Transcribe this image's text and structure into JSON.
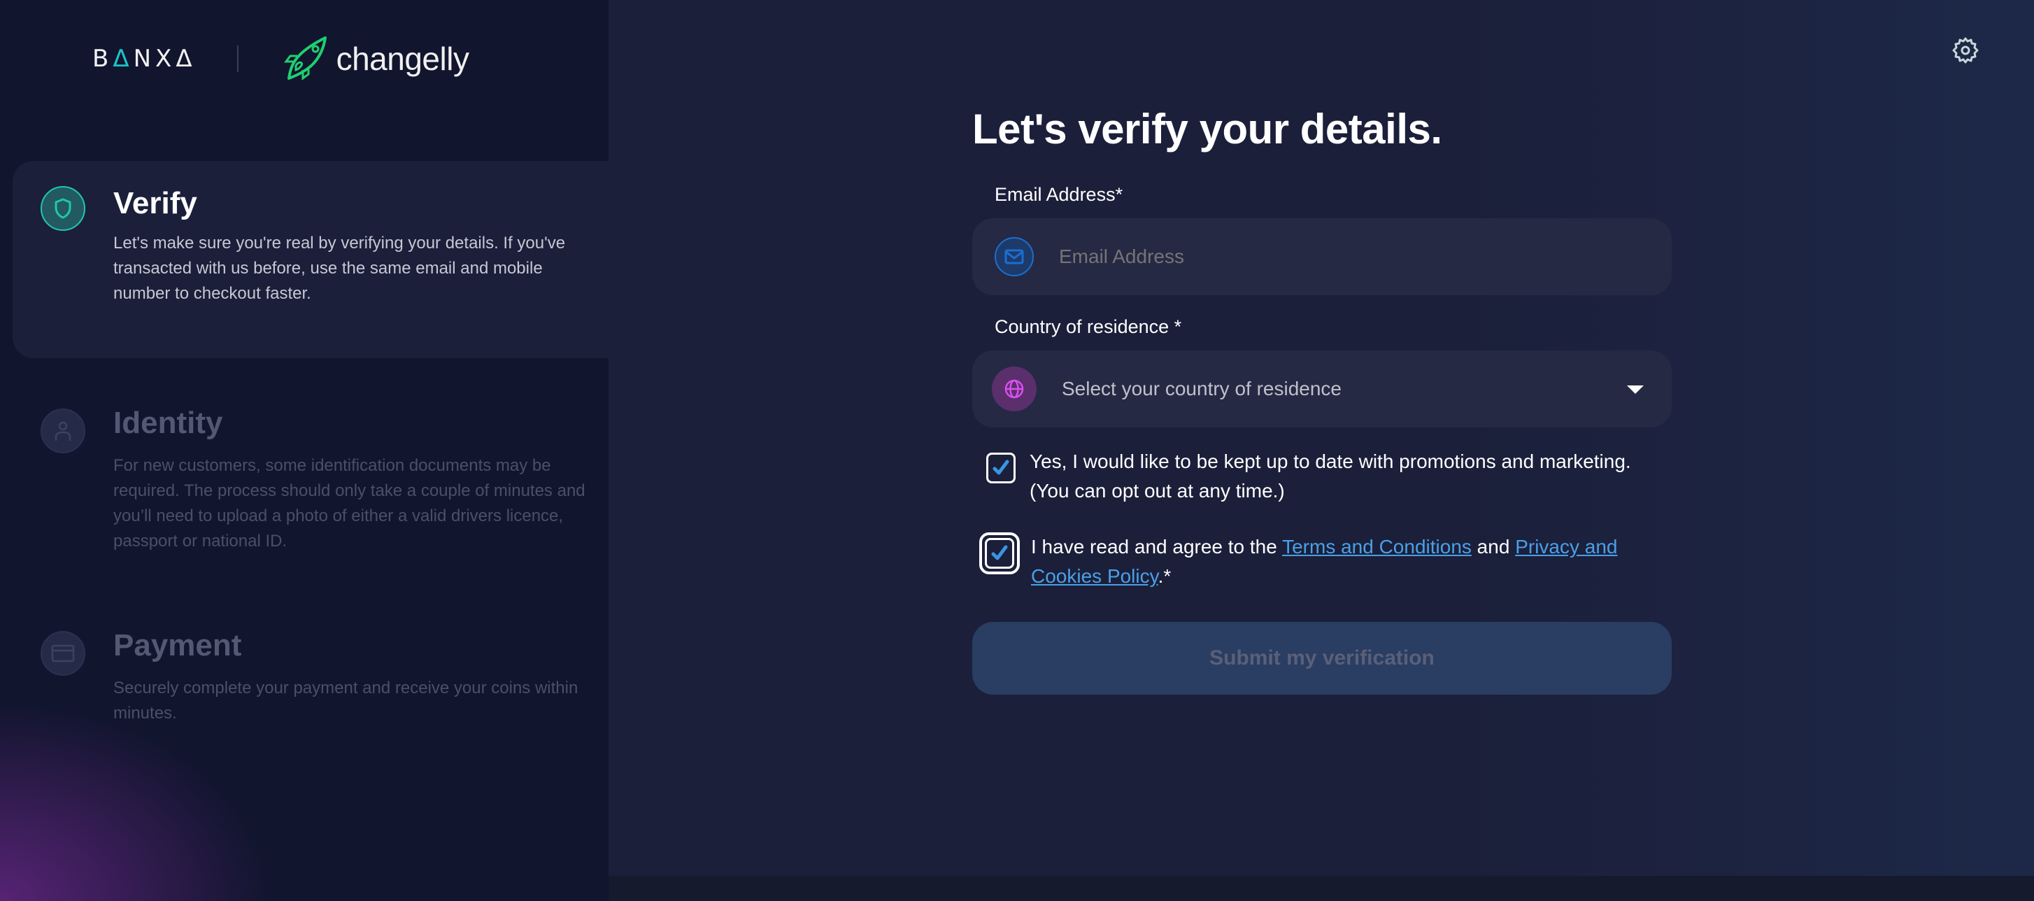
{
  "header": {
    "brand_banxa": [
      "B",
      "Δ",
      "N",
      "X",
      "Δ"
    ],
    "brand_changelly": "changelly",
    "settings_icon": "gear-icon"
  },
  "sidebar": {
    "steps": [
      {
        "title": "Verify",
        "icon": "shield-icon",
        "state": "active",
        "description": "Let's make sure you're real by verifying your details. If you've transacted with us before, use the same email and mobile number to checkout faster."
      },
      {
        "title": "Identity",
        "icon": "user-icon",
        "state": "inactive",
        "description": "For new customers, some identification documents may be required. The process should only take a couple of minutes and you’ll need to upload a photo of either a valid drivers licence, passport or national ID."
      },
      {
        "title": "Payment",
        "icon": "credit-card-icon",
        "state": "inactive",
        "description": "Securely complete your payment and receive your coins within minutes."
      }
    ]
  },
  "form": {
    "title": "Let's verify your details.",
    "email": {
      "label": "Email Address*",
      "placeholder": "Email Address",
      "value": ""
    },
    "country": {
      "label": "Country of residence *",
      "placeholder": "Select your country of residence",
      "selected": ""
    },
    "marketing_checkbox": {
      "checked": true,
      "label": "Yes, I would like to be kept up to date with promotions and marketing. (You can opt out at any time.)"
    },
    "terms_checkbox": {
      "checked": true,
      "focused": true,
      "prefix": "I have read and agree to the ",
      "terms_link": "Terms and Conditions",
      "middle": " and ",
      "privacy_link": "Privacy and Cookies Policy",
      "suffix": ".*"
    },
    "submit_label": "Submit my verification",
    "submit_disabled": true
  },
  "colors": {
    "accent_teal": "#1ec8b0",
    "link_blue": "#4aa0e6",
    "email_icon_blue": "#1a6fd0",
    "globe_icon_magenta": "#d94ff0",
    "changelly_green": "#1fcf6f"
  }
}
